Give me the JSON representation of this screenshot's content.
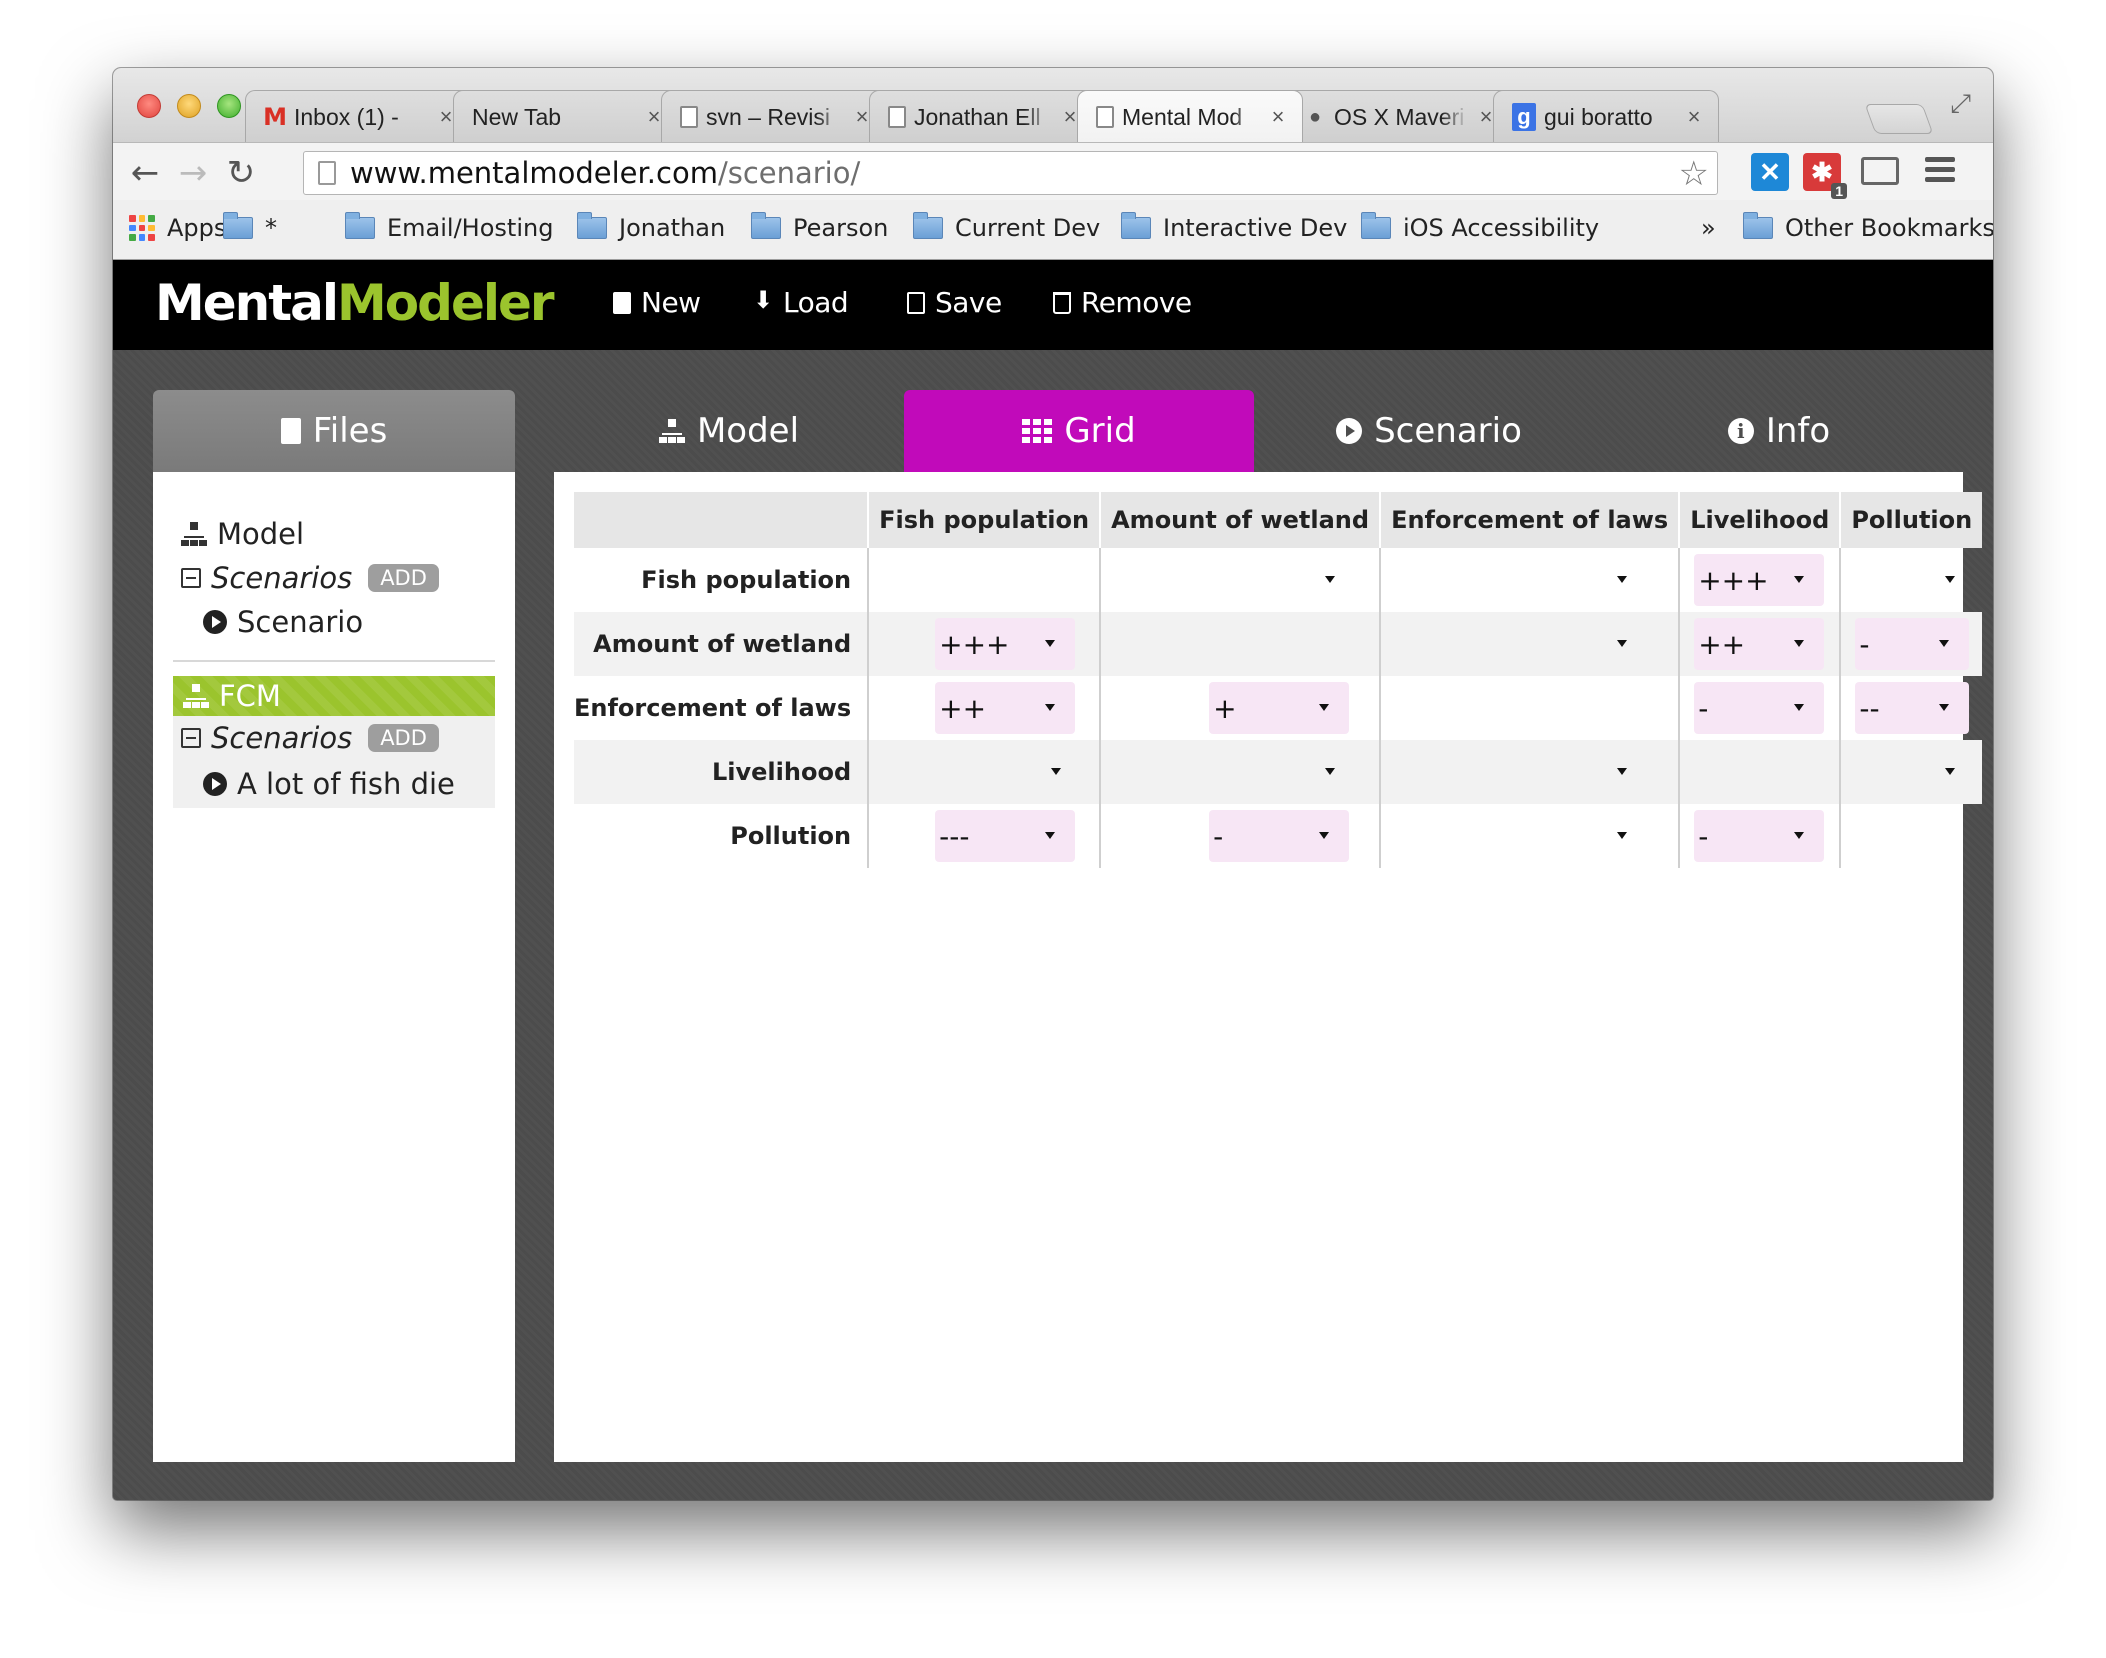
{
  "browser": {
    "tabs": [
      {
        "title": "Inbox (1) -",
        "favicon": "gmail-icon",
        "active": false
      },
      {
        "title": "New Tab",
        "favicon": "",
        "active": false
      },
      {
        "title": "svn – Revisi",
        "favicon": "page-icon",
        "active": false
      },
      {
        "title": "Jonathan Ell",
        "favicon": "page-icon",
        "active": false
      },
      {
        "title": "Mental Mod",
        "favicon": "page-icon",
        "active": true
      },
      {
        "title": "OS X Maveri",
        "favicon": "apple-icon",
        "active": false
      },
      {
        "title": "gui boratto",
        "favicon": "google-icon",
        "active": false
      }
    ],
    "url_host": "www.mentalmodeler.com",
    "url_path": "/scenario/",
    "bookmarks": {
      "apps": "Apps",
      "star_folder": "*",
      "items": [
        "Email/Hosting",
        "Jonathan",
        "Pearson",
        "Current Dev",
        "Interactive Dev",
        "iOS Accessibility"
      ],
      "overflow": "»",
      "other": "Other Bookmarks"
    }
  },
  "app": {
    "logo_part1": "Mental",
    "logo_part2": "Modeler",
    "logo_accent_color": "#9bc42d",
    "menu": {
      "new": "New",
      "load": "Load",
      "save": "Save",
      "remove": "Remove"
    },
    "files_tab": "Files",
    "tabs": {
      "model": "Model",
      "grid": "Grid",
      "scenario": "Scenario",
      "info": "Info"
    },
    "active_tab_color": "#c10aba",
    "tree": {
      "model_label": "Model",
      "model_scenarios_label": "Scenarios",
      "model_add": "ADD",
      "model_scenario_item": "Scenario",
      "fcm_label": "FCM",
      "fcm_scenarios_label": "Scenarios",
      "fcm_add": "ADD",
      "fcm_scenario_item": "A lot of fish die"
    },
    "grid": {
      "columns": [
        "Fish population",
        "Amount of wetland",
        "Enforcement of laws",
        "Livelihood",
        "Pollution"
      ],
      "rows": [
        {
          "label": "Fish population",
          "cells": [
            "__self__",
            "",
            "",
            "+++",
            ""
          ]
        },
        {
          "label": "Amount of wetland",
          "cells": [
            "+++",
            "__self__",
            "",
            "++",
            "-"
          ]
        },
        {
          "label": "Enforcement of laws",
          "cells": [
            "++",
            "+",
            "__self__",
            "-",
            "--"
          ]
        },
        {
          "label": "Livelihood",
          "cells": [
            "",
            "",
            "",
            "__self__",
            ""
          ]
        },
        {
          "label": "Pollution",
          "cells": [
            "---",
            "-",
            "",
            "-",
            "__self__"
          ]
        }
      ]
    }
  }
}
